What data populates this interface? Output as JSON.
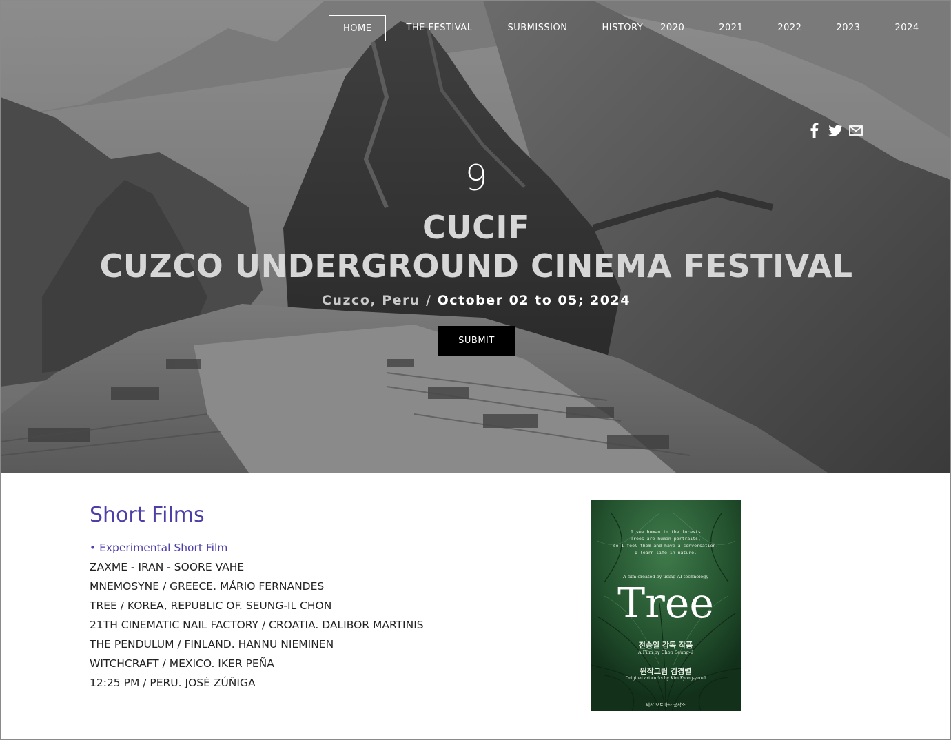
{
  "nav": {
    "items": [
      "HOME",
      "THE FESTIVAL",
      "SUBMISSION",
      "HISTORY",
      "2020",
      "2021",
      "2022",
      "2023",
      "2024"
    ],
    "active": "HOME"
  },
  "social": {
    "icons": [
      "facebook-icon",
      "twitter-icon",
      "mail-icon"
    ]
  },
  "hero": {
    "edition": "9",
    "title_line1": "CUCIF",
    "title_line2": "CUZCO UNDERGROUND CINEMA FESTIVAL",
    "location": "Cuzco, Peru",
    "separator": " / ",
    "dates": "October 02 to 05; 2024",
    "submit_label": "SUBMIT"
  },
  "content": {
    "heading": "Short Films",
    "category": "• Experimental Short Film",
    "films": [
      "ZAXME - IRAN - SOORE VAHE",
      "MNEMOSYNE / GREECE. MÁRIO FERNANDES",
      "TREE / KOREA, REPUBLIC OF. SEUNG-IL CHON",
      "21TH CINEMATIC NAIL FACTORY / CROATIA. DALIBOR MARTINIS",
      "THE PENDULUM / FINLAND. HANNU NIEMINEN",
      "WITCHCRAFT / MEXICO. IKER PEÑA",
      "12:25 PM / PERU. JOSÉ ZÚÑIGA"
    ]
  },
  "poster": {
    "quote_lines": [
      "I see human in the forests",
      "Trees are human portraits,",
      "so I feel them and have a conversation.",
      "I learn life in nature."
    ],
    "ai_line": "A film created by using AI technology",
    "title": "Tree",
    "korean_director": "전승일 감독 작품",
    "english_director": "A Film by Chon Seung-il",
    "korean_art": "원작그림 김경렬",
    "english_art": "Original artworks by Kim Kyong-yeoul",
    "producer": "제작 오토마타 공작소"
  },
  "colors": {
    "accent": "#4d3fa8",
    "text": "#222222",
    "button_bg": "#000000"
  }
}
